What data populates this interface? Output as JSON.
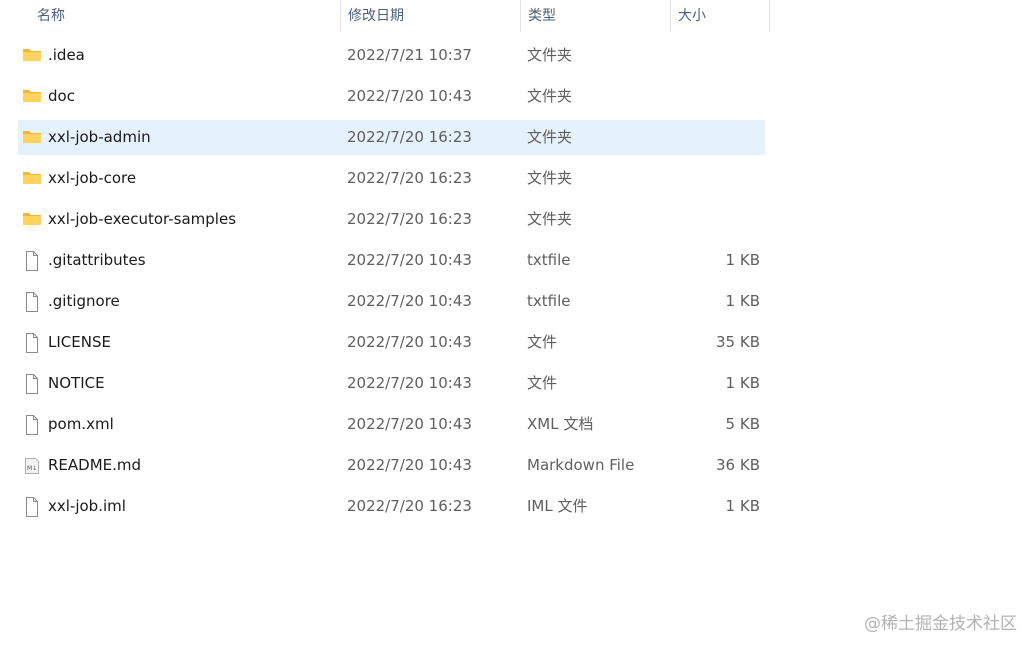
{
  "columns": {
    "name": "名称",
    "date": "修改日期",
    "type": "类型",
    "size": "大小"
  },
  "selected_index": 2,
  "files": [
    {
      "name": ".idea",
      "date": "2022/7/21 10:37",
      "type": "文件夹",
      "size": "",
      "icon": "folder-icon"
    },
    {
      "name": "doc",
      "date": "2022/7/20 10:43",
      "type": "文件夹",
      "size": "",
      "icon": "folder-icon"
    },
    {
      "name": "xxl-job-admin",
      "date": "2022/7/20 16:23",
      "type": "文件夹",
      "size": "",
      "icon": "folder-icon"
    },
    {
      "name": "xxl-job-core",
      "date": "2022/7/20 16:23",
      "type": "文件夹",
      "size": "",
      "icon": "folder-icon"
    },
    {
      "name": "xxl-job-executor-samples",
      "date": "2022/7/20 16:23",
      "type": "文件夹",
      "size": "",
      "icon": "folder-icon"
    },
    {
      "name": ".gitattributes",
      "date": "2022/7/20 10:43",
      "type": "txtfile",
      "size": "1 KB",
      "icon": "file-icon"
    },
    {
      "name": ".gitignore",
      "date": "2022/7/20 10:43",
      "type": "txtfile",
      "size": "1 KB",
      "icon": "file-icon"
    },
    {
      "name": "LICENSE",
      "date": "2022/7/20 10:43",
      "type": "文件",
      "size": "35 KB",
      "icon": "file-icon"
    },
    {
      "name": "NOTICE",
      "date": "2022/7/20 10:43",
      "type": "文件",
      "size": "1 KB",
      "icon": "file-icon"
    },
    {
      "name": "pom.xml",
      "date": "2022/7/20 10:43",
      "type": "XML 文档",
      "size": "5 KB",
      "icon": "file-icon"
    },
    {
      "name": "README.md",
      "date": "2022/7/20 10:43",
      "type": "Markdown File",
      "size": "36 KB",
      "icon": "markdown-file-icon"
    },
    {
      "name": "xxl-job.iml",
      "date": "2022/7/20 16:23",
      "type": "IML 文件",
      "size": "1 KB",
      "icon": "file-icon"
    }
  ],
  "watermark": "@稀土掘金技术社区",
  "colors": {
    "selection": "#e5f1fb",
    "folder": "#ffd35e",
    "header_text": "#4c607a"
  }
}
